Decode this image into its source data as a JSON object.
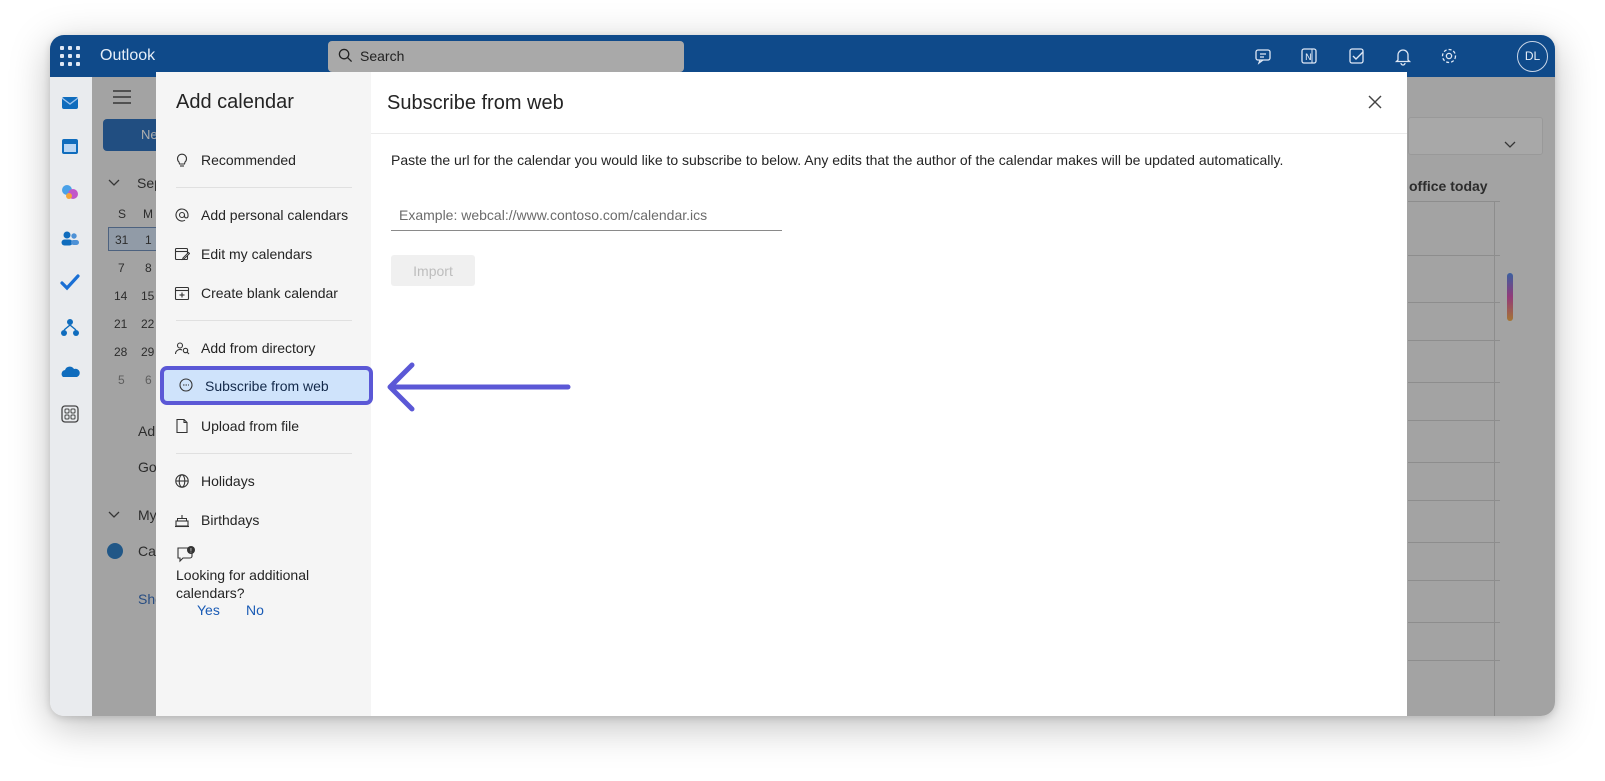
{
  "app": {
    "name": "Outlook"
  },
  "search": {
    "label": "Search"
  },
  "user": {
    "initials": "DL"
  },
  "background": {
    "new_label": "Ne",
    "month_label": "Sep",
    "weekday_headers": [
      "S",
      "M"
    ],
    "date_rows": [
      [
        "31",
        "1"
      ],
      [
        "7",
        "8"
      ],
      [
        "14",
        "15"
      ],
      [
        "21",
        "22"
      ],
      [
        "28",
        "29"
      ],
      [
        "5",
        "6"
      ]
    ],
    "add_label": "Ad",
    "go_label": "Go",
    "my_label": "My",
    "cal_label": "Cal",
    "show_label": "Sho",
    "event_text": "office today"
  },
  "dialog": {
    "left_title": "Add calendar",
    "nav": [
      {
        "label": "Recommended",
        "icon": "lightbulb-icon"
      },
      {
        "label": "Add personal calendars",
        "icon": "at-sign-icon"
      },
      {
        "label": "Edit my calendars",
        "icon": "edit-calendar-icon"
      },
      {
        "label": "Create blank calendar",
        "icon": "calendar-add-icon"
      },
      {
        "label": "Add from directory",
        "icon": "people-search-icon"
      },
      {
        "label": "Subscribe from web",
        "icon": "web-link-icon",
        "selected": true
      },
      {
        "label": "Upload from file",
        "icon": "file-upload-icon"
      },
      {
        "label": "Holidays",
        "icon": "globe-icon"
      },
      {
        "label": "Birthdays",
        "icon": "cake-icon"
      }
    ],
    "feedback": {
      "question": "Looking for additional calendars?",
      "yes": "Yes",
      "no": "No"
    },
    "right_title": "Subscribe from web",
    "description": "Paste the url for the calendar you would like to subscribe to below. Any edits that the author of the calendar makes will be updated automatically.",
    "url_placeholder": "Example: webcal://www.contoso.com/calendar.ics",
    "url_value": "",
    "import_label": "Import"
  },
  "colors": {
    "topbar": "#0f4a8a",
    "accent": "#5b58d6",
    "selected_bg": "#cfe3fb",
    "link": "#1a5bb5"
  }
}
